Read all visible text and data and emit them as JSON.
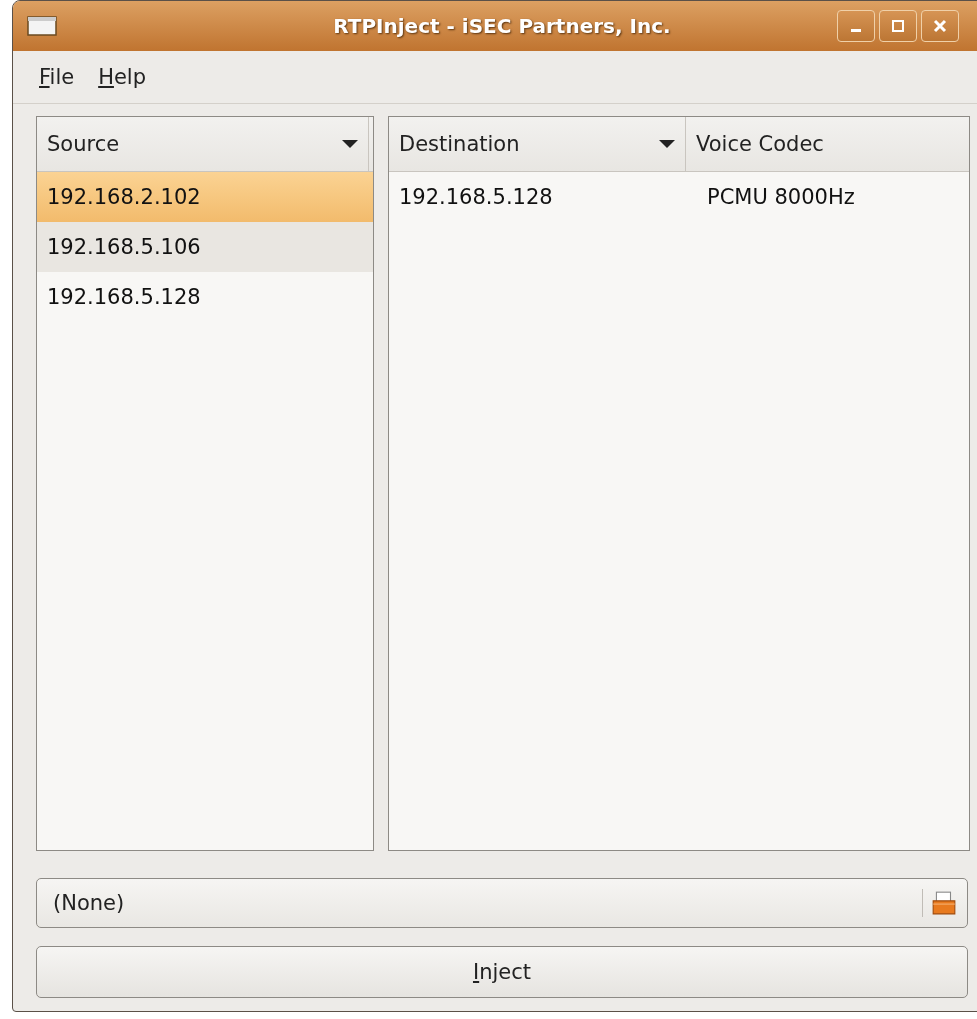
{
  "window": {
    "title": "RTPInject - iSEC Partners, Inc."
  },
  "menu": [
    "File",
    "Help"
  ],
  "source_table": {
    "columns": [
      {
        "label": "Source",
        "sort_arrow": true
      }
    ],
    "rows": [
      {
        "cells": [
          "192.168.2.102"
        ],
        "selected": true,
        "hovered": false
      },
      {
        "cells": [
          "192.168.5.106"
        ],
        "selected": false,
        "hovered": true
      },
      {
        "cells": [
          "192.168.5.128"
        ],
        "selected": false,
        "hovered": false
      }
    ]
  },
  "destination_table": {
    "columns": [
      {
        "label": "Destination",
        "sort_arrow": true
      },
      {
        "label": "Voice Codec",
        "sort_arrow": false
      }
    ],
    "rows": [
      {
        "cells": [
          "192.168.5.128",
          "PCMU 8000Hz"
        ],
        "selected": false,
        "hovered": false
      }
    ]
  },
  "file_chooser": {
    "value": "(None)"
  },
  "inject_button": {
    "label": "Inject"
  }
}
